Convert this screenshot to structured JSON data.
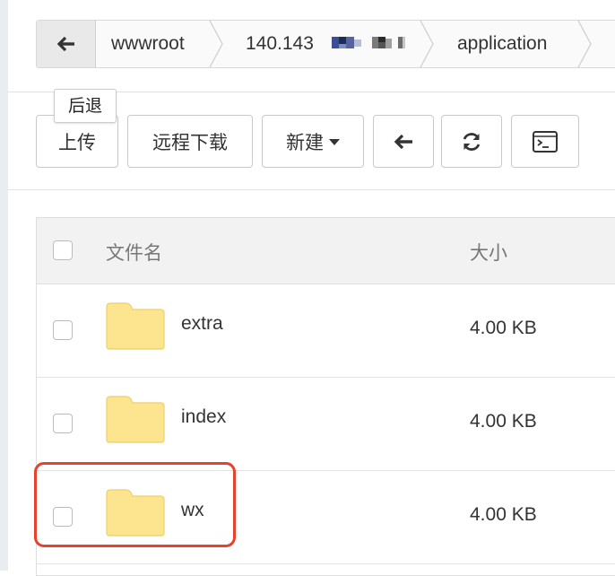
{
  "breadcrumb": {
    "back_tooltip": "后退",
    "items": [
      "wwwroot",
      "140.143",
      "application"
    ]
  },
  "toolbar": {
    "upload": "上传",
    "remote_download": "远程下载",
    "new": "新建",
    "back_icon": "arrow-left-icon",
    "refresh_icon": "refresh-icon",
    "terminal_icon": "terminal-icon"
  },
  "table": {
    "columns": [
      "文件名",
      "大小"
    ],
    "rows": [
      {
        "name": "extra",
        "size": "4.00 KB",
        "icon": "folder-icon"
      },
      {
        "name": "index",
        "size": "4.00 KB",
        "icon": "folder-icon"
      },
      {
        "name": "wx",
        "size": "4.00 KB",
        "icon": "folder-icon"
      }
    ]
  },
  "colors": {
    "folder": "#fde58f",
    "folder_stroke": "#efce6a",
    "highlight": "#e8412d"
  }
}
